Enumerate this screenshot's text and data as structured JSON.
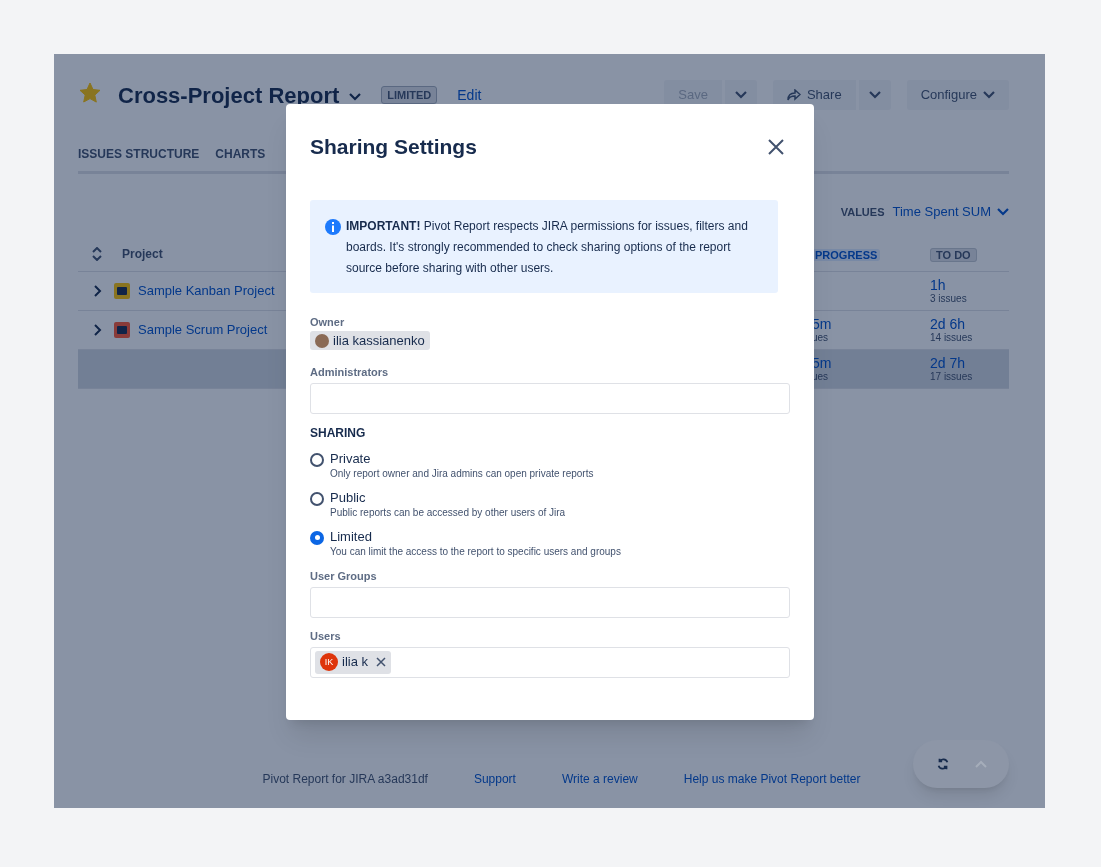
{
  "page": {
    "title": "Cross-Project Report",
    "badge": "LIMITED",
    "edit_link": "Edit",
    "starred": true,
    "buttons": [
      {
        "label": "Save",
        "kind": "split",
        "disabled": true
      },
      {
        "label": "Share",
        "kind": "split-icon",
        "disabled": false
      },
      {
        "label": "Configure",
        "kind": "dropdown",
        "disabled": false
      }
    ],
    "tabs": [
      {
        "label": "ISSUES STRUCTURE",
        "selected": false
      },
      {
        "label": "CHARTS",
        "selected": false
      }
    ],
    "values_label": "VALUES",
    "values_select": "Time Spent SUM",
    "table": {
      "columns": [
        "Project",
        "PROGRESS",
        "TO DO"
      ],
      "rows": [
        {
          "project": "Sample Kanban Project",
          "total": false,
          "to_do": {
            "value": "1h",
            "sub": "3 issues"
          }
        },
        {
          "project": "Sample Scrum Project",
          "total": false,
          "progress": {
            "value": "5m",
            "sub": "ues"
          },
          "to_do": {
            "value": "2d 6h",
            "sub": "14 issues"
          }
        },
        {
          "total": true,
          "progress": {
            "value": "5m",
            "sub": "ues"
          },
          "to_do": {
            "value": "2d 7h",
            "sub": "17 issues"
          }
        }
      ]
    },
    "footer": {
      "version": "Pivot Report for JIRA a3ad31df",
      "links": [
        "Support",
        "Write a review",
        "Help us make Pivot Report better"
      ]
    }
  },
  "dialog": {
    "title": "Sharing Settings",
    "notice": "**IMPORTANT!** Pivot Report respects JIRA permissions for issues, filters and boards. It's strongly recommended to check sharing options of the report source before sharing with other users.",
    "owner": {
      "label": "Owner",
      "name": "ilia kassianenko"
    },
    "administrators": {
      "label": "Administrators"
    },
    "sharing_heading": "SHARING",
    "options": [
      {
        "label": "Private",
        "description": "Only report owner and Jira admins can open private reports",
        "selected": false
      },
      {
        "label": "Public",
        "description": "Public reports can be accessed by other users of Jira",
        "selected": false
      },
      {
        "label": "Limited",
        "description": "You can limit the access to the report to specific users and groups",
        "selected": true
      }
    ],
    "user_groups": {
      "label": "User Groups"
    },
    "users": {
      "label": "Users",
      "chips": [
        {
          "initials": "IK",
          "name": "ilia k"
        }
      ]
    }
  }
}
